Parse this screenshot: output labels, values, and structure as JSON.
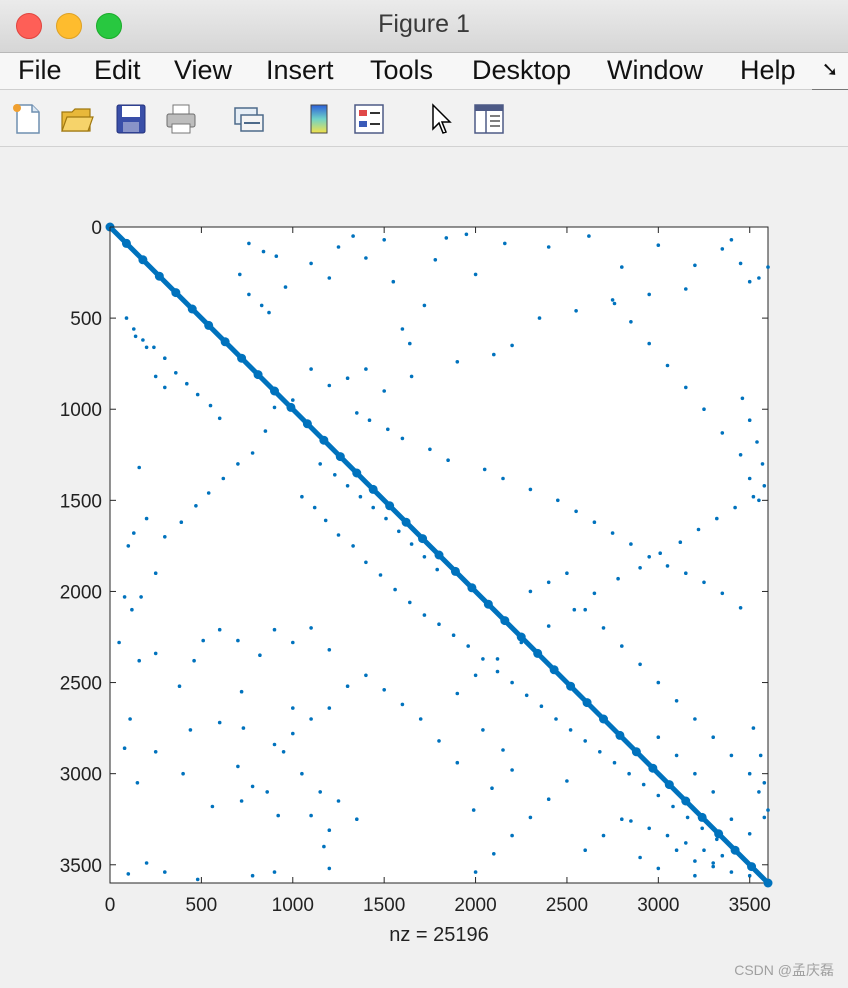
{
  "window": {
    "title": "Figure 1"
  },
  "menubar": {
    "items": [
      "File",
      "Edit",
      "View",
      "Insert",
      "Tools",
      "Desktop",
      "Window",
      "Help"
    ]
  },
  "toolbar": {
    "icons": [
      "new-file-icon",
      "open-folder-icon",
      "save-icon",
      "print-icon",
      "link-icon",
      "colorbar-icon",
      "legend-icon",
      "pointer-icon",
      "property-editor-icon"
    ]
  },
  "colors": {
    "marker": "#0072bd",
    "axes_bg": "#ffffff",
    "figure_bg": "#f0f0f0"
  },
  "chart_data": {
    "type": "scatter",
    "title": "",
    "xlabel": "nz = 25196",
    "ylabel": "",
    "xlim": [
      0,
      3600
    ],
    "ylim": [
      3600,
      0
    ],
    "xticks": [
      0,
      500,
      1000,
      1500,
      2000,
      2500,
      3000,
      3500
    ],
    "yticks": [
      0,
      500,
      1000,
      1500,
      2000,
      2500,
      3000,
      3500
    ],
    "grid": false,
    "matrix_size": 3600,
    "nz": 25196,
    "diagonal_band": true,
    "series": [
      {
        "values": [
          [
            140,
            600
          ],
          [
            200,
            660
          ],
          [
            250,
            820
          ],
          [
            300,
            880
          ],
          [
            160,
            1320
          ],
          [
            130,
            1680
          ],
          [
            200,
            1600
          ],
          [
            100,
            1750
          ],
          [
            80,
            2030
          ],
          [
            120,
            2100
          ],
          [
            50,
            2280
          ],
          [
            160,
            2380
          ],
          [
            250,
            2340
          ],
          [
            380,
            2520
          ],
          [
            460,
            2380
          ],
          [
            510,
            2270
          ],
          [
            600,
            2210
          ],
          [
            700,
            2270
          ],
          [
            720,
            2550
          ],
          [
            820,
            2350
          ],
          [
            900,
            2210
          ],
          [
            1000,
            2280
          ],
          [
            1100,
            2200
          ],
          [
            1200,
            2320
          ],
          [
            110,
            2700
          ],
          [
            80,
            2860
          ],
          [
            150,
            3050
          ],
          [
            250,
            2880
          ],
          [
            400,
            3000
          ],
          [
            440,
            2760
          ],
          [
            560,
            3180
          ],
          [
            720,
            3150
          ],
          [
            780,
            3070
          ],
          [
            860,
            3100
          ],
          [
            920,
            3230
          ],
          [
            1100,
            3230
          ],
          [
            1200,
            3310
          ],
          [
            1170,
            3400
          ],
          [
            200,
            3490
          ],
          [
            100,
            3550
          ],
          [
            300,
            3540
          ],
          [
            480,
            3580
          ],
          [
            780,
            3560
          ],
          [
            900,
            3540
          ],
          [
            1200,
            3520
          ],
          [
            730,
            2750
          ],
          [
            600,
            2720
          ],
          [
            900,
            2840
          ],
          [
            700,
            2960
          ],
          [
            1000,
            2640
          ],
          [
            760,
            90
          ],
          [
            840,
            135
          ],
          [
            910,
            160
          ],
          [
            710,
            260
          ],
          [
            760,
            370
          ],
          [
            830,
            430
          ],
          [
            870,
            470
          ],
          [
            960,
            330
          ],
          [
            1100,
            200
          ],
          [
            1200,
            280
          ],
          [
            1250,
            110
          ],
          [
            1330,
            50
          ],
          [
            1400,
            170
          ],
          [
            1500,
            70
          ],
          [
            1550,
            300
          ],
          [
            1600,
            560
          ],
          [
            1640,
            640
          ],
          [
            1720,
            430
          ],
          [
            1780,
            180
          ],
          [
            1840,
            60
          ],
          [
            1950,
            40
          ],
          [
            2000,
            260
          ],
          [
            2160,
            90
          ],
          [
            2400,
            110
          ],
          [
            2620,
            50
          ],
          [
            2800,
            220
          ],
          [
            3000,
            100
          ],
          [
            3200,
            210
          ],
          [
            3350,
            120
          ],
          [
            3450,
            200
          ],
          [
            3500,
            300
          ],
          [
            3550,
            280
          ],
          [
            3600,
            220
          ],
          [
            3400,
            70
          ],
          [
            3150,
            340
          ],
          [
            2950,
            370
          ],
          [
            2760,
            420
          ],
          [
            2550,
            460
          ],
          [
            2350,
            500
          ],
          [
            2200,
            650
          ],
          [
            2100,
            700
          ],
          [
            1900,
            740
          ],
          [
            1650,
            820
          ],
          [
            1500,
            900
          ],
          [
            1400,
            780
          ],
          [
            1300,
            830
          ],
          [
            1200,
            870
          ],
          [
            1100,
            780
          ],
          [
            1000,
            950
          ],
          [
            900,
            990
          ],
          [
            850,
            1120
          ],
          [
            780,
            1240
          ],
          [
            700,
            1300
          ],
          [
            620,
            1380
          ],
          [
            540,
            1460
          ],
          [
            470,
            1530
          ],
          [
            390,
            1620
          ],
          [
            300,
            1700
          ],
          [
            250,
            1900
          ],
          [
            170,
            2030
          ],
          [
            1350,
            1020
          ],
          [
            1420,
            1060
          ],
          [
            1520,
            1110
          ],
          [
            1600,
            1160
          ],
          [
            1750,
            1220
          ],
          [
            1850,
            1280
          ],
          [
            2050,
            1330
          ],
          [
            2150,
            1380
          ],
          [
            2300,
            1440
          ],
          [
            2450,
            1500
          ],
          [
            2550,
            1560
          ],
          [
            2650,
            1620
          ],
          [
            2750,
            1680
          ],
          [
            2850,
            1740
          ],
          [
            2950,
            1810
          ],
          [
            3050,
            1860
          ],
          [
            3150,
            1900
          ],
          [
            3250,
            1950
          ],
          [
            3350,
            2010
          ],
          [
            3450,
            2090
          ],
          [
            3550,
            1500
          ],
          [
            3500,
            1380
          ],
          [
            3450,
            1250
          ],
          [
            3350,
            1130
          ],
          [
            3250,
            1000
          ],
          [
            3150,
            880
          ],
          [
            3050,
            760
          ],
          [
            2950,
            640
          ],
          [
            2850,
            520
          ],
          [
            2750,
            400
          ],
          [
            1050,
            1480
          ],
          [
            1120,
            1540
          ],
          [
            1180,
            1610
          ],
          [
            1250,
            1690
          ],
          [
            1330,
            1750
          ],
          [
            1400,
            1840
          ],
          [
            1480,
            1910
          ],
          [
            1560,
            1990
          ],
          [
            1640,
            2060
          ],
          [
            1720,
            2130
          ],
          [
            1800,
            2180
          ],
          [
            1880,
            2240
          ],
          [
            1960,
            2300
          ],
          [
            2040,
            2370
          ],
          [
            2120,
            2440
          ],
          [
            2200,
            2500
          ],
          [
            2280,
            2570
          ],
          [
            2360,
            2630
          ],
          [
            2440,
            2700
          ],
          [
            2520,
            2760
          ],
          [
            2600,
            2820
          ],
          [
            2680,
            2880
          ],
          [
            2760,
            2940
          ],
          [
            2840,
            3000
          ],
          [
            2920,
            3060
          ],
          [
            3000,
            3120
          ],
          [
            3080,
            3180
          ],
          [
            3160,
            3240
          ],
          [
            3240,
            3300
          ],
          [
            3320,
            3360
          ],
          [
            2300,
            2000
          ],
          [
            2400,
            1950
          ],
          [
            2500,
            1900
          ],
          [
            2600,
            2100
          ],
          [
            2700,
            2200
          ],
          [
            2800,
            2300
          ],
          [
            2900,
            2400
          ],
          [
            3000,
            2500
          ],
          [
            3100,
            2600
          ],
          [
            3200,
            2700
          ],
          [
            3300,
            2800
          ],
          [
            3400,
            2900
          ],
          [
            3500,
            3000
          ],
          [
            3550,
            3100
          ],
          [
            3600,
            3200
          ],
          [
            3400,
            3250
          ],
          [
            3300,
            3100
          ],
          [
            3200,
            3000
          ],
          [
            3100,
            2900
          ],
          [
            3000,
            2800
          ],
          [
            2000,
            3540
          ],
          [
            2100,
            3440
          ],
          [
            2200,
            3340
          ],
          [
            2300,
            3240
          ],
          [
            2400,
            3140
          ],
          [
            2500,
            3040
          ],
          [
            2600,
            3420
          ],
          [
            2700,
            3340
          ],
          [
            2800,
            3250
          ],
          [
            2900,
            3460
          ],
          [
            3000,
            3520
          ],
          [
            3100,
            3420
          ],
          [
            3200,
            3560
          ],
          [
            3300,
            3490
          ],
          [
            3400,
            3400
          ],
          [
            3500,
            3330
          ],
          [
            3580,
            3240
          ],
          [
            3580,
            3050
          ],
          [
            3560,
            2900
          ],
          [
            3520,
            2750
          ],
          [
            2040,
            2760
          ],
          [
            2150,
            2870
          ],
          [
            2200,
            2980
          ],
          [
            2090,
            3080
          ],
          [
            1990,
            3200
          ],
          [
            1900,
            2940
          ],
          [
            1800,
            2820
          ],
          [
            1700,
            2700
          ],
          [
            1600,
            2620
          ],
          [
            1500,
            2540
          ],
          [
            1400,
            2460
          ],
          [
            1300,
            2520
          ],
          [
            1200,
            2640
          ],
          [
            1100,
            2700
          ],
          [
            1000,
            2780
          ],
          [
            950,
            2880
          ],
          [
            1050,
            3000
          ],
          [
            1150,
            3100
          ],
          [
            1250,
            3150
          ],
          [
            1350,
            3250
          ],
          [
            1900,
            2560
          ],
          [
            2000,
            2460
          ],
          [
            2120,
            2370
          ],
          [
            2250,
            2280
          ],
          [
            2400,
            2190
          ],
          [
            2540,
            2100
          ],
          [
            2650,
            2010
          ],
          [
            2780,
            1930
          ],
          [
            2900,
            1870
          ],
          [
            3010,
            1790
          ],
          [
            3120,
            1730
          ],
          [
            3220,
            1660
          ],
          [
            3320,
            1600
          ],
          [
            3420,
            1540
          ],
          [
            3520,
            1480
          ],
          [
            3580,
            1420
          ],
          [
            3570,
            1300
          ],
          [
            3540,
            1180
          ],
          [
            3500,
            1060
          ],
          [
            3460,
            940
          ],
          [
            600,
            1050
          ],
          [
            550,
            980
          ],
          [
            480,
            920
          ],
          [
            420,
            860
          ],
          [
            360,
            800
          ],
          [
            300,
            720
          ],
          [
            240,
            660
          ],
          [
            180,
            620
          ],
          [
            130,
            560
          ],
          [
            90,
            500
          ],
          [
            1150,
            1300
          ],
          [
            1230,
            1360
          ],
          [
            1300,
            1420
          ],
          [
            1370,
            1480
          ],
          [
            1440,
            1540
          ],
          [
            1510,
            1600
          ],
          [
            1580,
            1670
          ],
          [
            1650,
            1740
          ],
          [
            1720,
            1810
          ],
          [
            1790,
            1880
          ],
          [
            3200,
            3480
          ],
          [
            3300,
            3510
          ],
          [
            3400,
            3540
          ],
          [
            3500,
            3560
          ],
          [
            3350,
            3450
          ],
          [
            3250,
            3420
          ],
          [
            3150,
            3380
          ],
          [
            3050,
            3340
          ],
          [
            2950,
            3300
          ],
          [
            2850,
            3260
          ]
        ]
      }
    ]
  },
  "watermark": {
    "text": "CSDN @孟庆磊"
  }
}
